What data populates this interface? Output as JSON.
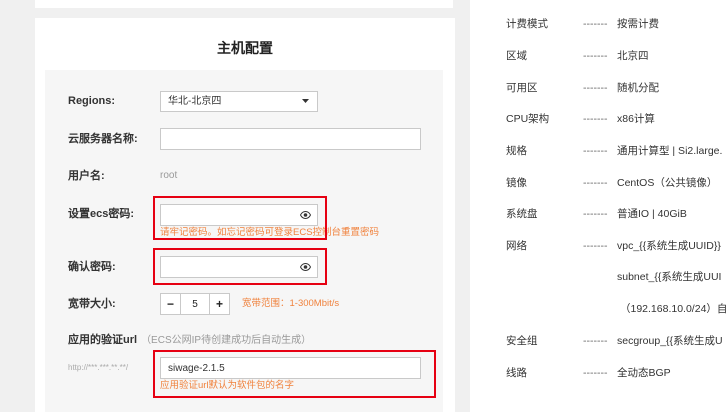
{
  "host_config": {
    "title": "主机配置",
    "region": {
      "label": "Regions:",
      "value": "华北-北京四"
    },
    "server_name": {
      "label": "云服务器名称:"
    },
    "username": {
      "label": "用户名:",
      "value": "root"
    },
    "password": {
      "label": "设置ecs密码:",
      "hint": "请牢记密码。如忘记密码可登录ECS控制台重置密码"
    },
    "confirm_password": {
      "label": "确认密码:"
    },
    "bandwidth": {
      "label": "宽带大小:",
      "value": "5",
      "decrement_label": "−",
      "increment_label": "+",
      "hint": "宽带范围：1-300Mbit/s"
    },
    "verify_url": {
      "label": "应用的验证url",
      "note": "（ECS公网IP待创建成功后自动生成）",
      "prefix": "http://***.***.**.**/",
      "value": "siwage-2.1.5",
      "hint": "应用验证url默认为软件包的名字"
    }
  },
  "summary": {
    "separator": "-------",
    "rows": [
      {
        "label": "计费模式",
        "value": "按需计费"
      },
      {
        "label": "区域",
        "value": "北京四"
      },
      {
        "label": "可用区",
        "value": "随机分配"
      },
      {
        "label": "CPU架构",
        "value": "x86计算"
      },
      {
        "label": "规格",
        "value": "通用计算型 | Si2.large."
      },
      {
        "label": "镜像",
        "value": "CentOS（公共镜像）"
      },
      {
        "label": "系统盘",
        "value": "普通IO | 40GiB"
      },
      {
        "label": "网络",
        "value": "vpc_{{系统生成UUID}}"
      },
      {
        "value": "subnet_{{系统生成UUI"
      },
      {
        "value": "（192.168.10.0/24）自"
      },
      {
        "label": "安全组",
        "value": "secgroup_{{系统生成U"
      },
      {
        "label": "线路",
        "value": "全动态BGP"
      }
    ]
  },
  "colors": {
    "hint": "#f0823d",
    "highlight": "#e60012"
  },
  "icons": {
    "password_toggle": "eye-icon",
    "select_caret": "caret-down-icon"
  }
}
